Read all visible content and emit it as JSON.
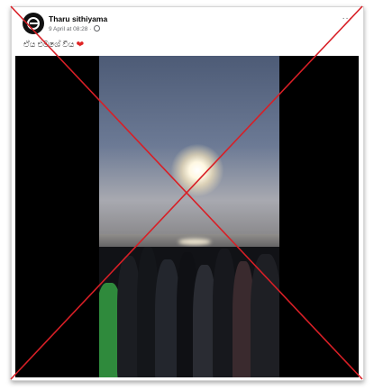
{
  "post": {
    "author": "Tharu sithiyama",
    "timestamp": "9 April at 08:28 ·",
    "caption": "ඒය එමශේ වීය",
    "caption_emoji": "❤",
    "more_label": "···"
  },
  "icons": {
    "avatar": "brand-logo",
    "privacy": "globe-icon",
    "menu": "more-options-icon",
    "reaction": "heart-icon",
    "overlay": "red-cross-mark"
  },
  "colors": {
    "cross_overlay": "#d81f26",
    "heart": "#e02424",
    "author_text": "#050505",
    "meta_text": "#65676b"
  }
}
